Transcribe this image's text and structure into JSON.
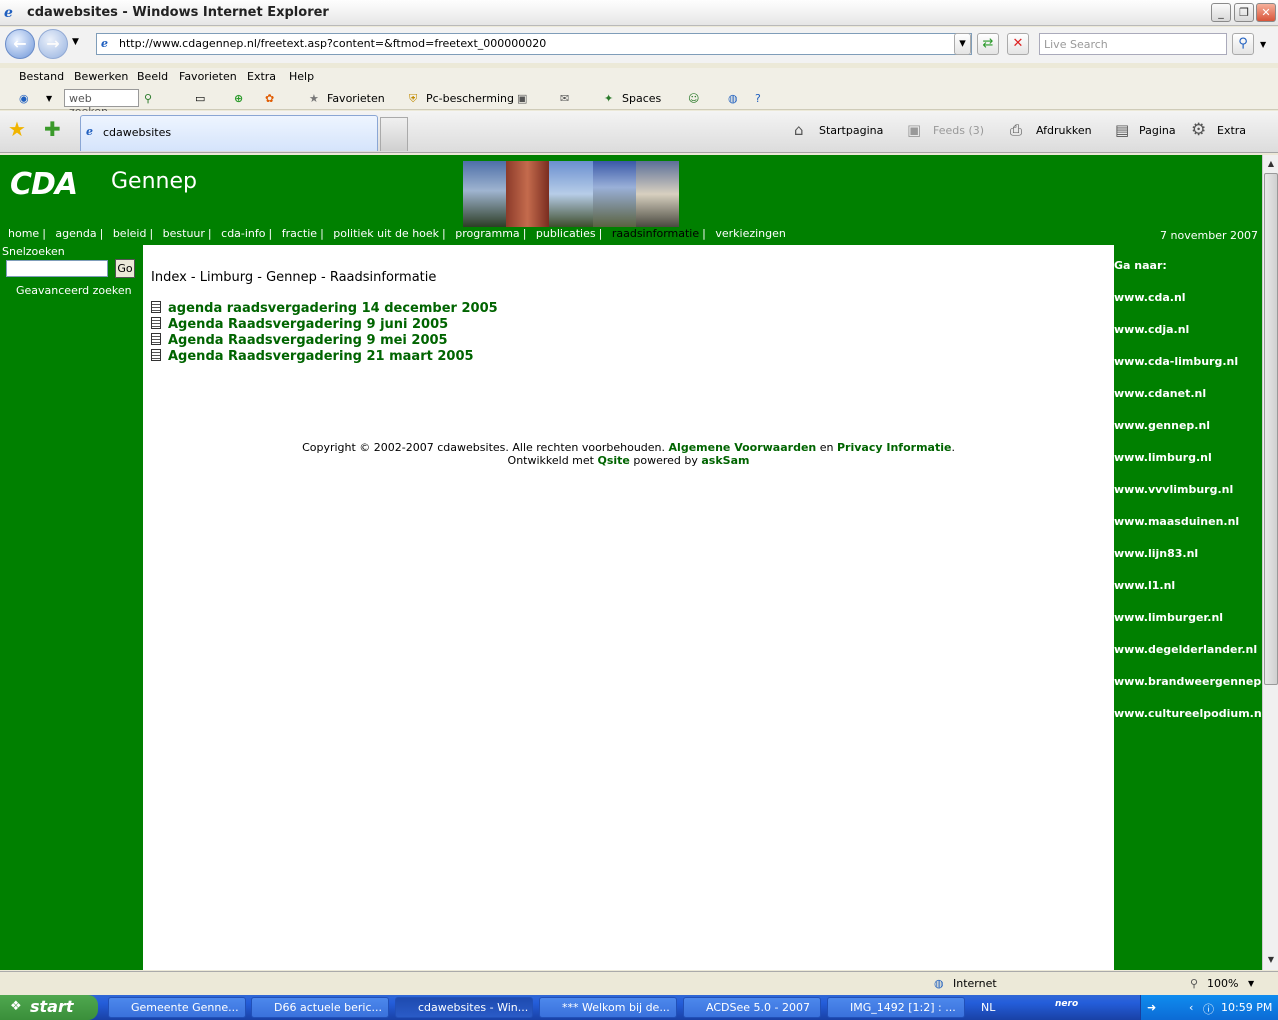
{
  "window": {
    "title": "cdawebsites - Windows Internet Explorer"
  },
  "address": {
    "url": "http://www.cdagennep.nl/freetext.asp?content=&ftmod=freetext_000000020",
    "search_placeholder": "Live Search"
  },
  "menu": [
    "Bestand",
    "Bewerken",
    "Beeld",
    "Favorieten",
    "Extra",
    "Help"
  ],
  "toolbar2": {
    "websearch": "web zoeken..",
    "favorieten": "Favorieten",
    "pc": "Pc-bescherming",
    "spaces": "Spaces"
  },
  "tab": {
    "label": "cdawebsites"
  },
  "cmdbar": {
    "home": "Startpagina",
    "feeds": "Feeds (3)",
    "print": "Afdrukken",
    "page": "Pagina",
    "tools": "Extra"
  },
  "site": {
    "logo": "CDA",
    "name": "Gennep",
    "date": "7 november 2007",
    "nav": [
      "home",
      "agenda",
      "beleid",
      "bestuur",
      "cda-info",
      "fractie",
      "politiek uit de hoek",
      "programma",
      "publicaties",
      "raadsinformatie",
      "verkiezingen"
    ],
    "quicksearch_label": "Snelzoeken",
    "go_label": "Go",
    "advanced_search": "Geavanceerd zoeken",
    "breadcrumb": "Index - Limburg - Gennep - Raadsinformatie",
    "documents": [
      "agenda raadsvergadering 14 december 2005",
      "Agenda Raadsvergadering 9 juni 2005",
      "Agenda Raadsvergadering 9 mei 2005",
      "Agenda Raadsvergadering 21 maart 2005"
    ],
    "copyright": {
      "prefix": "Copyright © 2002-2007 cdawebsites. Alle rechten voorbehouden.",
      "terms": "Algemene Voorwaarden",
      "and": "en",
      "privacy": "Privacy Informatie",
      "dev_prefix": "Ontwikkeld met",
      "qsite": "Qsite",
      "powered": "powered by",
      "asksam": "askSam"
    },
    "goto_label": "Ga naar:",
    "links": [
      "www.cda.nl",
      "www.cdja.nl",
      "www.cda-limburg.nl",
      "www.cdanet.nl",
      "www.gennep.nl",
      "www.limburg.nl",
      "www.vvvlimburg.nl",
      "www.maasduinen.nl",
      "www.lijn83.nl",
      "www.l1.nl",
      "www.limburger.nl",
      "www.degelderlander.nl",
      "www.brandweergennep.nl",
      "www.cultureelpodium.nl"
    ]
  },
  "status": {
    "zone": "Internet",
    "zoom": "100%"
  },
  "taskbar": {
    "start": "start",
    "tasks": [
      "Gemeente Genne...",
      "D66 actuele beric...",
      "cdawebsites - Win...",
      "*** Welkom bij de...",
      "ACDSee 5.0 - 2007",
      "IMG_1492 [1:2] : ..."
    ],
    "lang": "NL",
    "clock": "10:59 PM"
  }
}
